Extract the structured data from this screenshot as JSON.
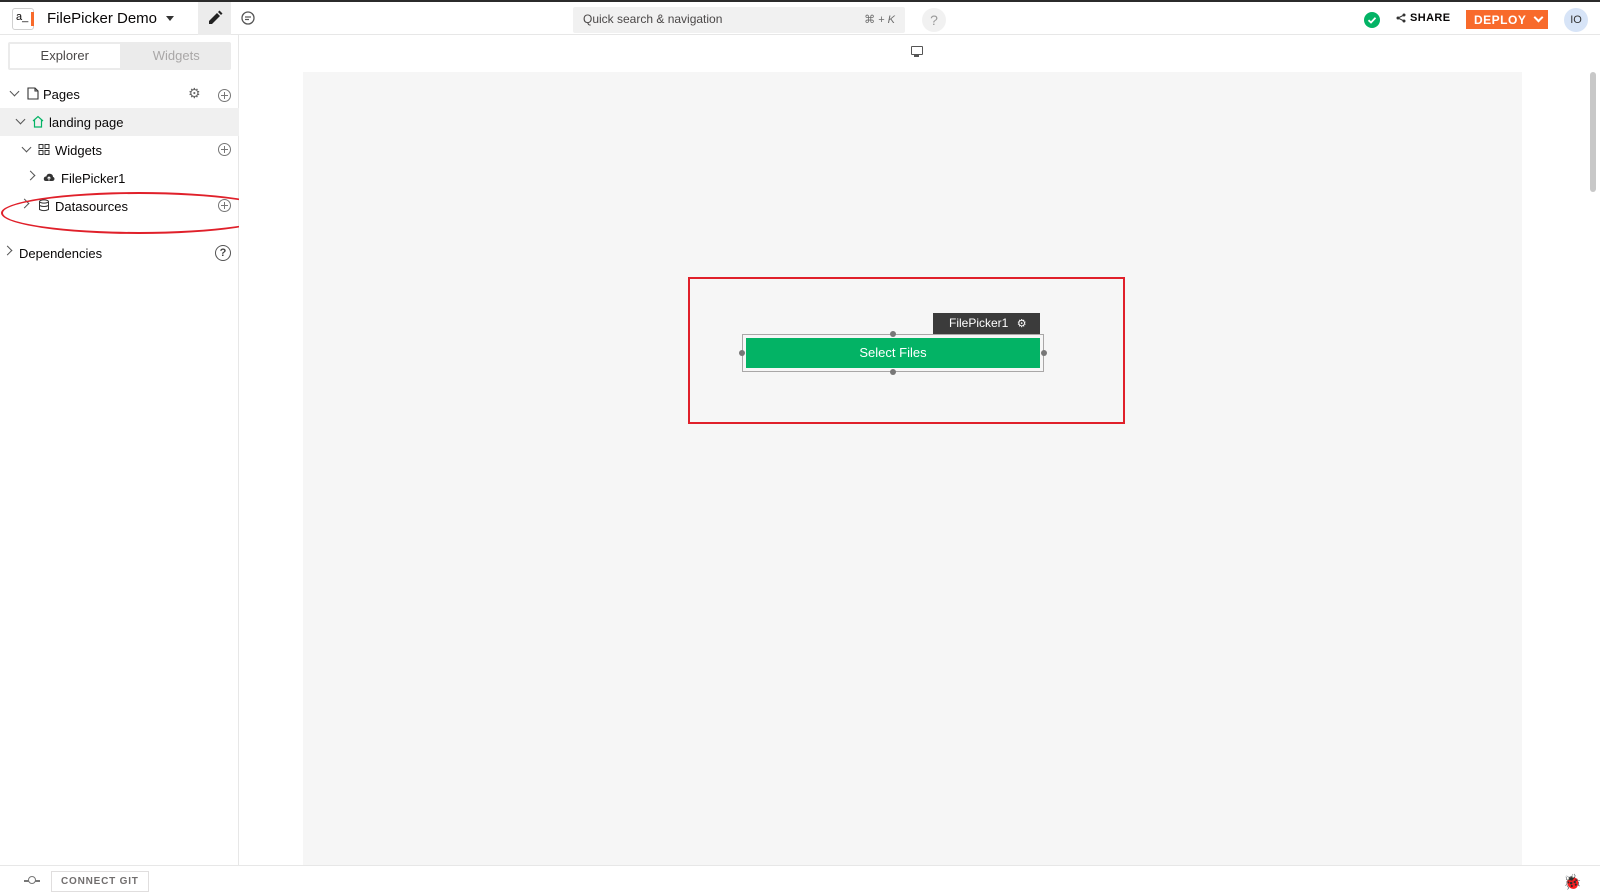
{
  "header": {
    "logo_text": "a_",
    "app_name": "FilePicker Demo",
    "search_placeholder": "Quick search & navigation",
    "search_shortcut": "⌘ + K",
    "help_label": "?",
    "share_label": "SHARE",
    "deploy_label": "DEPLOY",
    "avatar_initials": "IO"
  },
  "sidebar": {
    "tabs": [
      {
        "label": "Explorer",
        "active": true
      },
      {
        "label": "Widgets",
        "active": false
      }
    ],
    "tree": {
      "pages_label": "Pages",
      "page_name": "landing page",
      "widgets_label": "Widgets",
      "widget_item": "FilePicker1",
      "datasources_label": "Datasources",
      "dependencies_label": "Dependencies"
    }
  },
  "canvas": {
    "widget_name_tag": "FilePicker1",
    "filepicker_label": "Select Files",
    "accent_color": "#03b365"
  },
  "footer": {
    "connect_git_label": "CONNECT GIT"
  },
  "colors": {
    "brand": "#f86a2b",
    "success": "#03b365",
    "annotation": "#e0202a"
  }
}
